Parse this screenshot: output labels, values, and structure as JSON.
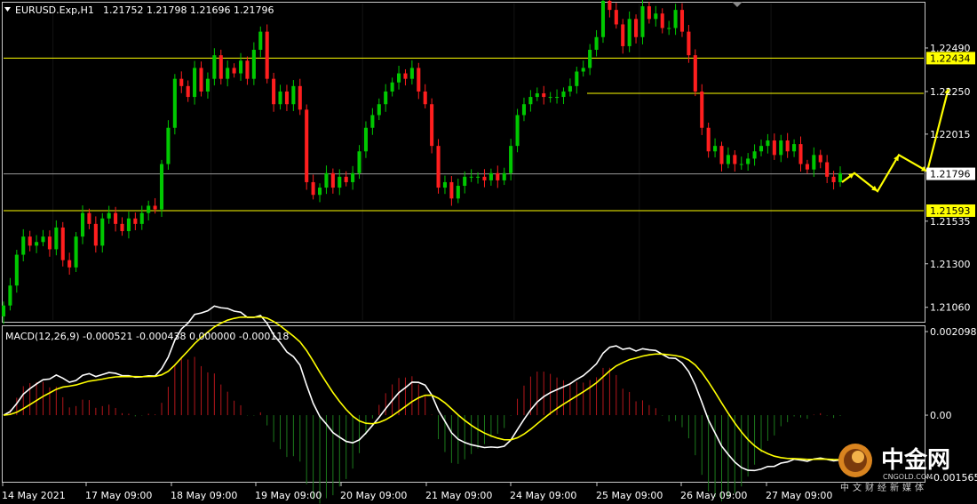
{
  "chart_header": {
    "symbol": "EURUSD.Exp,H1",
    "ohlc": "1.21752 1.21798 1.21696 1.21796"
  },
  "macd_header": "MACD(12,26,9) -0.000521 -0.000438 0.000000 -0.000118",
  "watermark": {
    "name": "中金网",
    "latin": "CNGOLD.COM",
    "tagline": "中文财经新媒体"
  },
  "colors": {
    "background": "#000000",
    "frame": "#c8c8c8",
    "bull": "#00c800",
    "bear": "#ff1e1e",
    "level": "#ffff00",
    "price_line": "#9a9a9a",
    "macd_main": "#ffffff",
    "macd_signal": "#ffff00",
    "hist_pos": "#b4161b",
    "hist_neg": "#1c7a1c"
  },
  "chart_data": [
    {
      "type": "candlestick",
      "name": "price",
      "y_ticks": [
        "1.22490",
        "1.22250",
        "1.22015",
        "1.21535",
        "1.21300",
        "1.21060"
      ],
      "y_tick_values": [
        1.2249,
        1.2225,
        1.22015,
        1.21535,
        1.213,
        1.2106
      ],
      "ylim": [
        1.2099,
        1.22735
      ],
      "x_ticks": [
        "14 May 2021",
        "17 May 09:00",
        "18 May 09:00",
        "19 May 09:00",
        "20 May 09:00",
        "21 May 09:00",
        "24 May 09:00",
        "25 May 09:00",
        "26 May 09:00",
        "27 May 09:00"
      ],
      "levels": [
        {
          "value": 1.22434,
          "label": "1.22434",
          "style": "boxed"
        },
        {
          "value": 1.21593,
          "label": "1.21593",
          "style": "boxed"
        },
        {
          "value": 1.2224,
          "label": "",
          "style": "partial"
        }
      ],
      "current_price": {
        "value": 1.21796,
        "label": "1.21796"
      },
      "closes": [
        1.2107,
        1.2118,
        1.2135,
        1.2145,
        1.214,
        1.2142,
        1.2145,
        1.2138,
        1.215,
        1.2132,
        1.2128,
        1.2145,
        1.2158,
        1.2152,
        1.214,
        1.2155,
        1.2158,
        1.2152,
        1.2148,
        1.2155,
        1.2152,
        1.2158,
        1.2162,
        1.216,
        1.2185,
        1.2205,
        1.2232,
        1.2228,
        1.2222,
        1.2238,
        1.2225,
        1.2232,
        1.2245,
        1.2232,
        1.2238,
        1.2235,
        1.2242,
        1.2232,
        1.2248,
        1.2258,
        1.2232,
        1.2218,
        1.2225,
        1.2218,
        1.2228,
        1.2215,
        1.2175,
        1.2168,
        1.2172,
        1.218,
        1.2172,
        1.2178,
        1.2175,
        1.218,
        1.2192,
        1.2205,
        1.2212,
        1.2218,
        1.2225,
        1.223,
        1.2235,
        1.2232,
        1.2238,
        1.2225,
        1.2218,
        1.2195,
        1.2172,
        1.2175,
        1.2166,
        1.2173,
        1.2178,
        1.2178,
        1.2178,
        1.2176,
        1.218,
        1.2176,
        1.218,
        1.2195,
        1.2212,
        1.2218,
        1.2222,
        1.2224,
        1.2222,
        1.2222,
        1.2222,
        1.2225,
        1.2228,
        1.2236,
        1.2238,
        1.2248,
        1.2255,
        1.2275,
        1.227,
        1.2262,
        1.225,
        1.2265,
        1.2255,
        1.2272,
        1.2265,
        1.2268,
        1.226,
        1.226,
        1.227,
        1.2258,
        1.2245,
        1.2225,
        1.2205,
        1.2192,
        1.2195,
        1.2185,
        1.219,
        1.2185,
        1.2185,
        1.2188,
        1.2192,
        1.2195,
        1.2198,
        1.219,
        1.2198,
        1.2192,
        1.2196,
        1.2185,
        1.2182,
        1.219,
        1.2186,
        1.2178,
        1.2175,
        1.218
      ],
      "weekly_separators_after": [
        7,
        31,
        54,
        77,
        96,
        116
      ]
    },
    {
      "type": "line",
      "name": "MACD",
      "y_ticks": [
        "0.002098",
        "0.00",
        "-0.001565"
      ],
      "y_tick_values": [
        0.002098,
        0.0,
        -0.001565
      ],
      "ylim": [
        -0.00165,
        0.00221
      ]
    }
  ]
}
